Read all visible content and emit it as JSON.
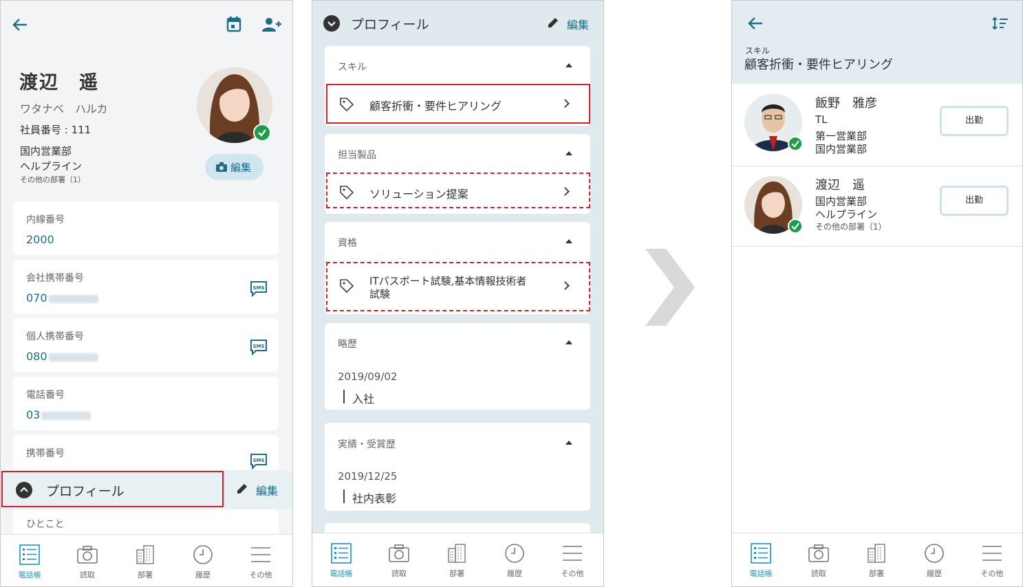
{
  "screen1": {
    "name": "渡辺　遥",
    "kana": "ワタナベ　ハルカ",
    "employee_no": "社員番号 : 111",
    "dept1": "国内営業部",
    "dept2": "ヘルプライン",
    "other_depts": "その他の部署（1）",
    "edit_photo": "編集",
    "fields": [
      {
        "label": "内線番号",
        "value": "2000"
      },
      {
        "label": "会社携帯番号",
        "value": "070"
      },
      {
        "label": "個人携帯番号",
        "value": "080"
      },
      {
        "label": "電話番号",
        "value": "03"
      },
      {
        "label": "携帯番号",
        "value": ""
      }
    ],
    "sms": "SMS",
    "profile_title": "プロフィール",
    "profile_edit": "編集",
    "hitokoto": "ひとこと"
  },
  "screen2": {
    "profile_title": "プロフィール",
    "profile_edit": "編集",
    "sections": [
      {
        "title": "スキル",
        "item": "顧客折衝・要件ヒアリング"
      },
      {
        "title": "担当製品",
        "item": "ソリューション提案"
      },
      {
        "title": "資格",
        "item_line1": "ITパスポート試験,基本情報技術者",
        "item_line2": "試験"
      },
      {
        "title": "略歴",
        "date": "2019/09/02",
        "text": "入社"
      },
      {
        "title": "実績・受賞歴",
        "date": "2019/12/25",
        "text": "社内表彰"
      }
    ]
  },
  "screen3": {
    "header_sub": "スキル",
    "header_title": "顧客折衝・要件ヒアリング",
    "people": [
      {
        "name": "飯野　雅彦",
        "line1": "TL",
        "line2": "第一営業部",
        "line3": "国内営業部",
        "button": "出勤"
      },
      {
        "name": "渡辺　遥",
        "line1": "国内営業部",
        "line2": "ヘルプライン",
        "line3": "その他の部署（1）",
        "button": "出勤"
      }
    ]
  },
  "nav": [
    "電話帳",
    "読取",
    "部署",
    "履歴",
    "その他"
  ],
  "colors": {
    "accent": "#1e6d86",
    "nav_active": "#1e8fbf",
    "highlight": "#d0222b",
    "status": "#1e9b4b"
  }
}
